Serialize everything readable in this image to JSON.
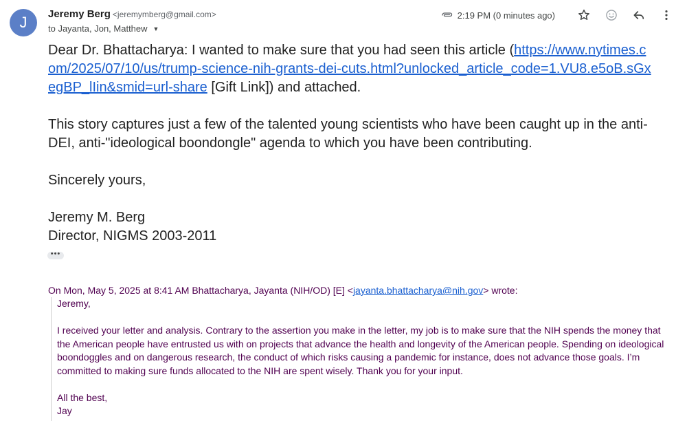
{
  "sender": {
    "avatar_letter": "J",
    "name": "Jeremy Berg",
    "email": "<jeremymberg@gmail.com>",
    "recipients": "to Jayanta, Jon, Matthew"
  },
  "header": {
    "timestamp": "2:19 PM (0 minutes ago)",
    "icons": [
      "attachment-icon",
      "star-icon",
      "emoji-icon",
      "reply-icon",
      "more-vert-icon"
    ]
  },
  "message": {
    "para1_prefix": "Dear Dr. Bhattacharya:  I wanted to make sure that you had seen this article (",
    "para1_link": "https://www.nytimes.com/2025/07/10/us/trump-science-nih-grants-dei-cuts.html?unlocked_article_code=1.VU8.e5oB.sGxegBP_lIin&smid=url-share",
    "para1_suffix": " [Gift Link]) and attached.",
    "para2": "This story captures just a few of the talented young scientists who have been caught up in the anti-DEI, anti-\"ideological boondongle\" agenda to which you have been contributing.",
    "closing": "Sincerely yours,",
    "signature_name": "Jeremy M. Berg",
    "signature_title": "Director, NIGMS 2003-2011",
    "ellipsis": "•••"
  },
  "quoted": {
    "header_prefix": "On Mon, May 5, 2025 at 8:41 AM Bhattacharya, Jayanta (NIH/OD) [E] <",
    "header_email": "jayanta.bhattacharya@nih.gov",
    "header_suffix": "> wrote:",
    "greeting": "Jeremy,",
    "body": "I received your letter and analysis. Contrary to the assertion you make in the letter, my job is to make sure that the NIH spends the money that the American people have entrusted us with on projects that advance the health and longevity of the American people. Spending on ideological boondoggles and on dangerous research, the conduct of which risks causing a pandemic for instance, does not advance those goals. I’m committed to making sure funds allocated to the NIH are spent wisely.  Thank you for your input.",
    "signoff": "All the best,",
    "signer": "Jay"
  },
  "colors": {
    "avatar": "#5b7fc7",
    "link": "#1a5fd0",
    "quoted_text": "#500050"
  }
}
